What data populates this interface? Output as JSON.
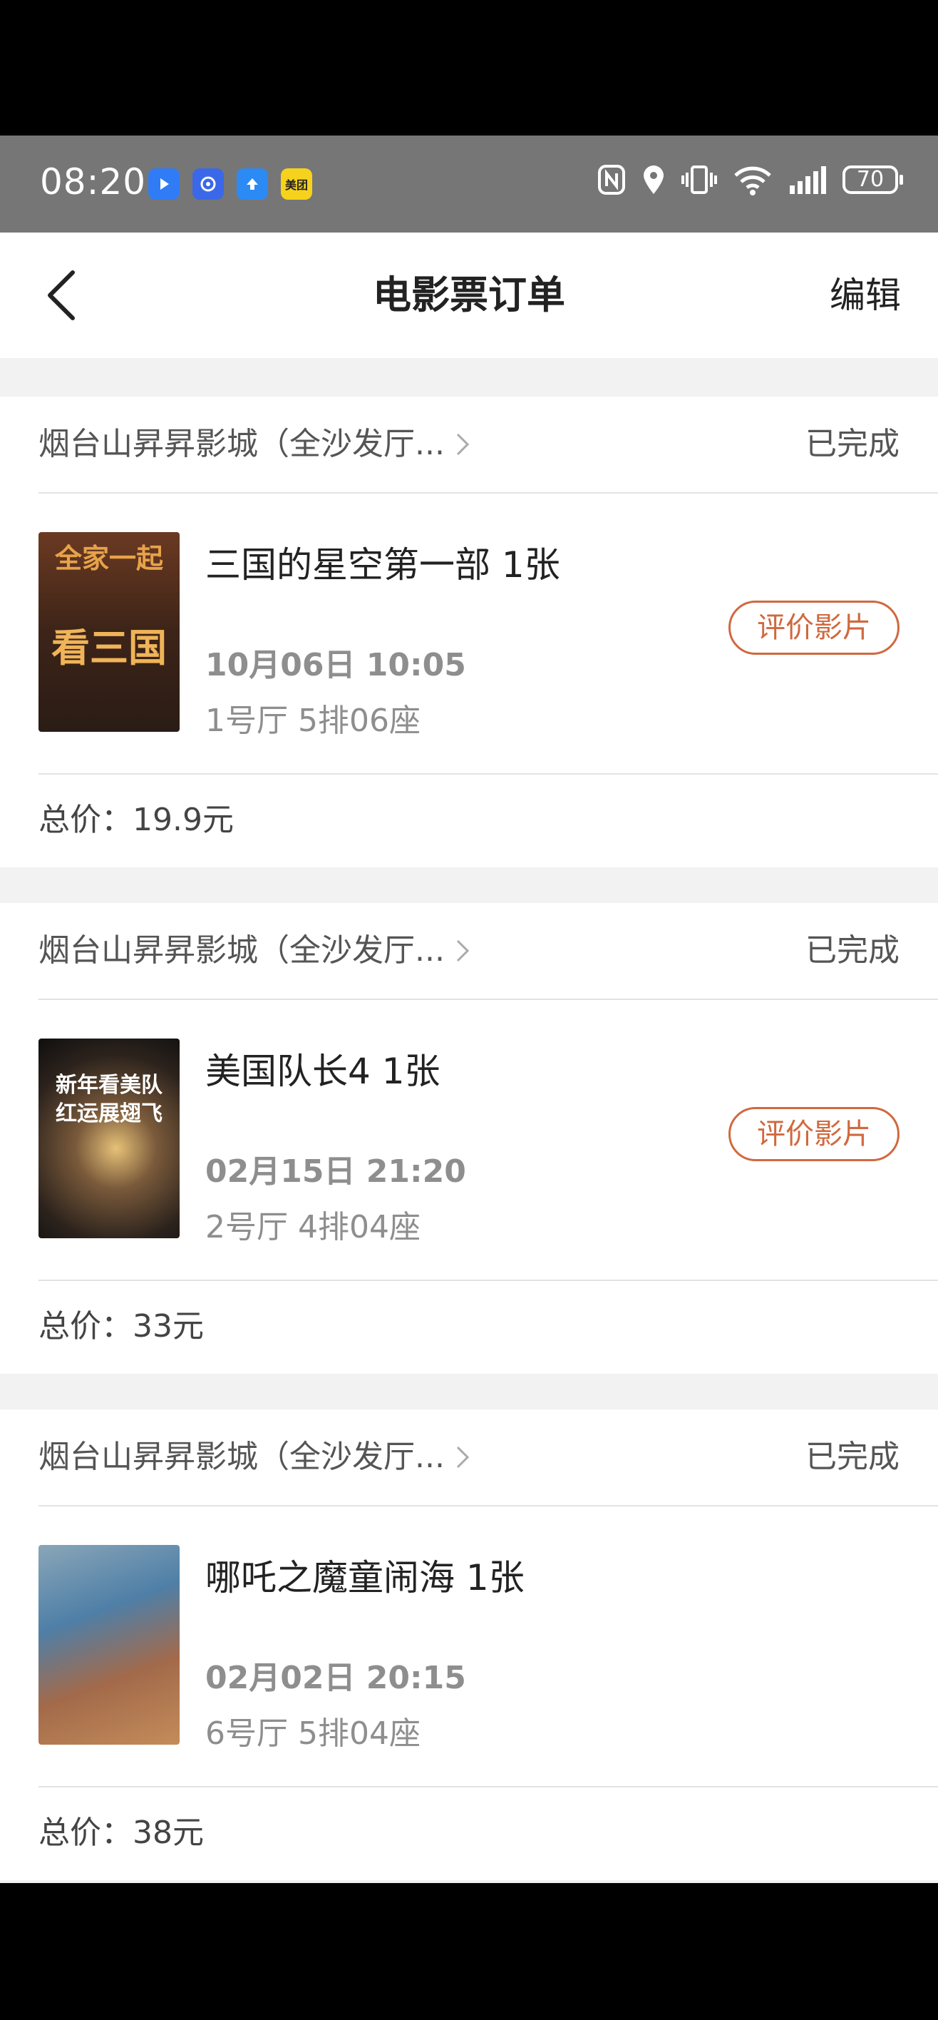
{
  "status_bar": {
    "time": "08:20",
    "app_icons": [
      {
        "icon": "blue-play-icon",
        "color": "#2f7cf6",
        "label": ""
      },
      {
        "icon": "blue-app-icon",
        "color": "#3a68e8",
        "label": ""
      },
      {
        "icon": "blue-upload-icon",
        "color": "#2c8af5",
        "label": ""
      },
      {
        "icon": "meituan-icon",
        "color": "#f7d21c",
        "label": "美团"
      }
    ],
    "battery": "70"
  },
  "nav": {
    "title": "电影票订单",
    "edit": "编辑"
  },
  "orders": [
    {
      "cinema": "烟台山昇昇影城（全沙发厅...",
      "status": "已完成",
      "poster": {
        "text_top": "全家一起",
        "text_mid": "看三国",
        "colors": [
          "#6b3a22",
          "#2a1c16"
        ]
      },
      "movie": "三国的星空第一部 1张",
      "showtime": "10月06日 10:05",
      "seat": "1号厅 5排06座",
      "rate_button": "评价影片",
      "total": "总价：19.9元"
    },
    {
      "cinema": "烟台山昇昇影城（全沙发厅...",
      "status": "已完成",
      "poster": {
        "text_top": "新年看美队",
        "text_mid": "红运展翅飞",
        "colors": [
          "#3b2e23",
          "#101010"
        ]
      },
      "movie": "美国队长4 1张",
      "showtime": "02月15日 21:20",
      "seat": "2号厅 4排04座",
      "rate_button": "评价影片",
      "total": "总价：33元"
    },
    {
      "cinema": "烟台山昇昇影城（全沙发厅...",
      "status": "已完成",
      "poster": {
        "text_top": "",
        "text_mid": "",
        "colors": [
          "#4f7fa7",
          "#c48c5a"
        ]
      },
      "movie": "哪吒之魔童闹海 1张",
      "showtime": "02月02日 20:15",
      "seat": "6号厅 5排04座",
      "rate_button": "",
      "total": "总价：38元"
    }
  ]
}
